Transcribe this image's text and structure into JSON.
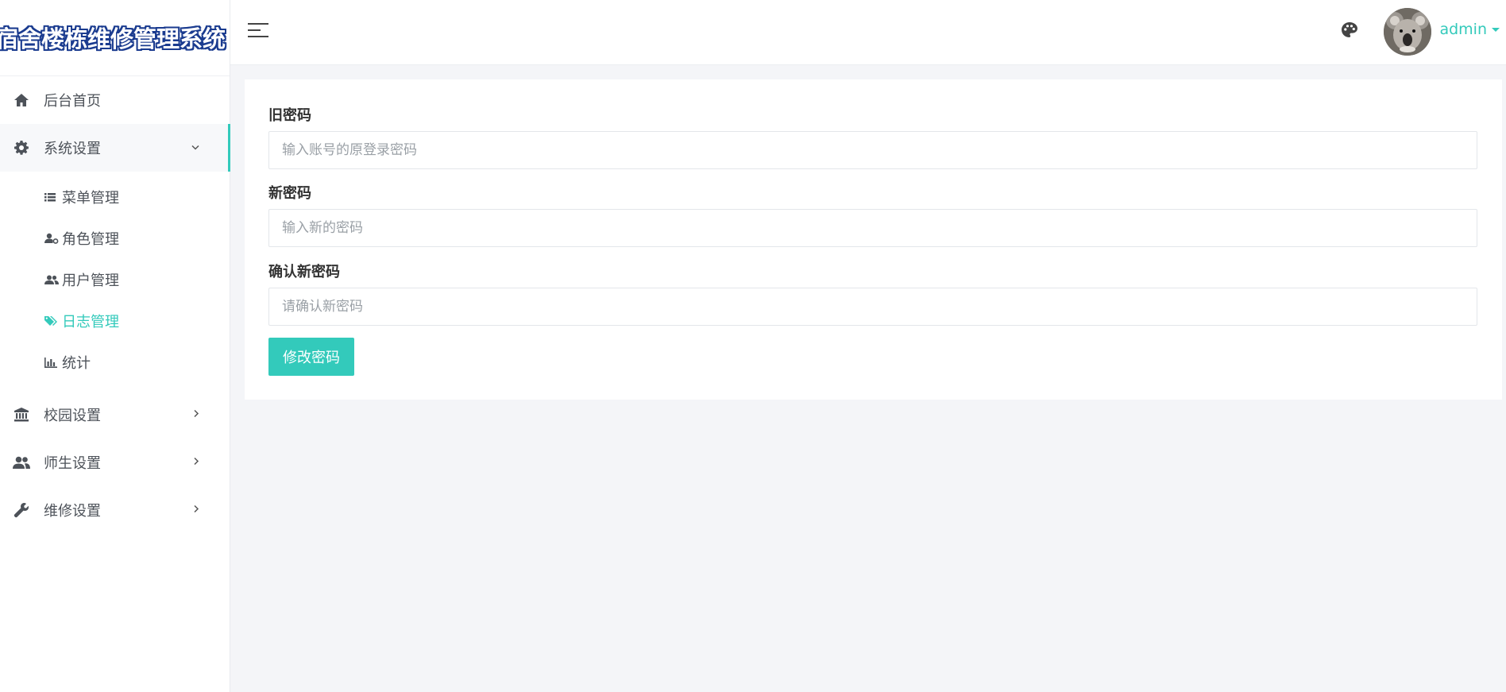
{
  "brand": {
    "title": "宿舍楼栋维修管理系统"
  },
  "sidebar": {
    "items": [
      {
        "label": "后台首页",
        "icon": "home-icon"
      },
      {
        "label": "系统设置",
        "icon": "gear-icon",
        "expanded": true,
        "children": [
          {
            "label": "菜单管理",
            "icon": "list-icon"
          },
          {
            "label": "角色管理",
            "icon": "user-cog-icon"
          },
          {
            "label": "用户管理",
            "icon": "users-icon"
          },
          {
            "label": "日志管理",
            "icon": "tags-icon",
            "active": true
          },
          {
            "label": "统计",
            "icon": "bar-chart-icon"
          }
        ]
      },
      {
        "label": "校园设置",
        "icon": "bank-icon"
      },
      {
        "label": "师生设置",
        "icon": "people-icon"
      },
      {
        "label": "维修设置",
        "icon": "wrench-icon"
      }
    ]
  },
  "header": {
    "username": "admin"
  },
  "form": {
    "old_password": {
      "label": "旧密码",
      "placeholder": "输入账号的原登录密码"
    },
    "new_password": {
      "label": "新密码",
      "placeholder": "输入新的密码"
    },
    "confirm_password": {
      "label": "确认新密码",
      "placeholder": "请确认新密码"
    },
    "submit_label": "修改密码"
  },
  "colors": {
    "accent": "#33cabb",
    "brand_outline": "#1a3b8f",
    "background": "#f4f5f8"
  }
}
